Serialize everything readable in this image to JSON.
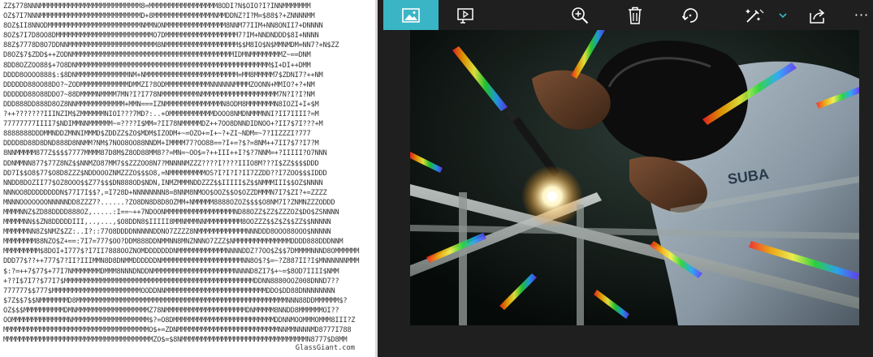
{
  "ascii_art": {
    "lines": [
      "ZZ$778NNNMMMMMMMMMMMMMMMMMMMMMMMMM8=MMMMMMMMMMMMMMMMM8ODI?N$OIO?I?INNMMMMMMM",
      "OZ$7I7NNNMMMMMMMMMMMMMMMMMMMMMMMMMD+8MMMMMMMMMMMMMMMNMMDDNZ?I?M=$88$?+ZNNNNMM",
      "8OZ$II8NNODMMMMMMMMMMMMMMMMMMMMMMMNMMNONMMMMMMMMMMMMMMM8NNM77IIM+NN8ONII7+DNNNN",
      "8OZ$7I7D8OO8DMMMMMMMMMMMMMMMMMMMMMMMMO7DMMMMMMMMMMMMMMMMMM7?IM+NNDNDDD$8I+NNNN",
      "88Z$7778D8O7DDNNMMMMMMMMMMMMMMMMMMMMMM8NMMMMMMMMMMMMMMMMMM$$M8IO$N$MMNMDM=NN7?+N$ZZ",
      "D8OZ$7$ZDD$++ZODNMMMMMMMMMMMMMMMMMMMMMMMMMMMMMMMMMMMMMMMMIDMNMMMMMMMMZ~==DNM",
      "8DD8OZZOO88$+7O8DNMMMMMMMMMMMMMMMMMMMMMMMMMMMMMMMMMMMMMMMMMMMMMMMM$I+DI++DMM",
      "DDDD8OOOO888$:$8DNMMMMMMMMMMMMMNM+NMMMMMMMMMMMMMMMMMMMMMMM=MM8MMMMM7$ZDNI7?++NM",
      "DDDDDD88OO88DO?~ZODMMMMMMMMMMMMDMMZI?8ODMMMMMMMMMMMNNNNNNMMMMZOONN+MMIO?+?+NM",
      "DDDDDD88O88DDO7~88DMMMMNMMMM7MN?I?I778NMMMMMMMMMNMMMMMMMMMMMMMMMMMMM7N?I?I?NM",
      "DDD888DD888D8OZ8NNMMMMMMMMMMMM+MMN===IZNMMMMMMMMMMMMMMN8ODM8MMMMMMMN8IOZI+I+$M",
      "?++???????IIINZIM$ZMMMMMMNIOI???7MD?:..+OMMMMMMMMMMMDOOO8NMDNMMMNNI?II7IIII?=M",
      "77777777IIII7$NDIMMNNMMMMMM~=????I$MM=?II78NMMMMMDZ++7OO8DNNDIDNOO+?II7$7I???+M",
      "8888888DDDMMNDDZMNNIMMMD$ZDDZZ$ZO$MDM$IZODM+~=OZO+=I+~?+ZI~NDM=~7?IIZZZI?777",
      "DDDD8D88D8DND888D8NNMM?NM$7NOO8OO88NNDM+IMMMM77?OO88==?I+=?$?=8NM++7II7$7?I7?M",
      "8NNMMMMM877Z$$$$7777MMMM87D8M$Z8OD88MM8??=MN=~OO$=?++III++I?$?7NNM=+?IIIII?O7NNN",
      "DDNMMNN877$77Z8NZ$$NNMZO87MM7$$ZZZOO8N7?MNNNNMZZZ????I????IIIO8M???I$ZZ$$$$DDD",
      "DD7I$$O8$77$O8D8ZZZ$NDDOOOZNMZZZO$$$O8,=NMMMMMMMMMOS?I?I?I?II7ZZDD??I7ZOO$$$IDDD",
      "NNDD8DOZII77$OZ8OOO$$Z77$$$DN888OD$NDN,INMZMMMNDDZZZ$$IIIII$Z$$NMMMIII$$OZ$NNNN",
      "NNNOO8DDDDDDDDN$77I7I$$?,=I728D+NNNNNNNN8=8NNM8NMOO$OOZ$$O$OZZDMMMN7I7$ZI?+=ZZZZ",
      "MNNNOOOOOOONNNNNDD8ZZZ7?......?ZO8DN8D8D8OZMM+NMMMMM8888OZOZ$$$$O8NM7I?ZNMNZZZODDD",
      "MMMMNNZ$ZD88DDDD888OZ,.....:I==~++7NDOONMMMMMMMMMMMMMMMMMND88OZZ$ZZ$ZZZOZ$DO$ZSNNNN",
      "MMMMMNN$$ZN8DDDDDIII,..,...,$O8DDN8$IIIII8MMNMMMNNMMMMMMMMM8OOZZZ$$Z$Z$$ZZ$$NNNNN",
      "MMMMMMNN8Z$NMZ$ZZ:..I?::77O8DDDDNNNNNDDNO7ZZZZ8NMMMMMMMMMMMMNNNDDD8OOO88OOO$NNNNN",
      "MMMMMMMM88NZO$Z+==:7I7=777$OO?DDM888DDNMMNN8MNZNNNO7ZZZ$NMMMMMMMMMMMMMMDDDD888DDDNNM",
      "MMMMMMMMM$8DOI+I777$?I7II7888OOZNOMDDDDDDDNMMMMMMMMMMMMNNNNDDZ?7OO$Z$$7DMMMMNNND8OMMMMMM",
      "DDD77$??++777$7?II?IIIMMN8D8DNMMDDDDDDNMMMMMMMMMMMMMMMMMMMMNN8O$?$=~?Z887II?I$MNNNNNNMMM",
      "$:?=++7$77$+77I7NMMMMMMMDMMM8NNNDNDDNMMMMMMMMMMMMMMMMMMMMNNNND8ZI7$+~=$8OD7IIII$NMM",
      "+??I$7I7?$77I7$MMMMMMMMMMMMMMMMMMMMMMMMMMMMMMMMMMMMMMMMMMMMMMMDDNN8880OOZ008DNND7??",
      "777777$$777$MMMMMMMMMMMMMMMMMMMMMMOODDNNMMMMMMMMMMMMMMMMMMMMMMMMMDDO$DD88DNNNNNNNN",
      "$7Z$$7$$NMMMMMMMD8MMMMMMMMMMMMMMMMMMMMMMMMMMMMMMMMMMMMMMMMMMMMMMMMMMMMNNN88DDMMMMMM$?",
      "OZ$$$MMMMMMMMMMDMNMMMMMMMMMMMMMMMMMMZ78NMMMMMMMMMMMMMMMMMMMMDNMMMMM8NNDD8MMMMMMOI??",
      "OOMMMMMMMMMMMMMMNMMMMMMMMMMMMMMMMMMM$?=O8DMMMMMMMMMMMMMMMMMMMMMMMMMDDNNMOOMMMOMMM8III?Z",
      "MMMMMMMMMMMMMMMMMMMMMMMMMMMMMMMMMMMMO$+=ZDNMMMMMMMMMMMMMMMMMMMMMMMMMNNMMNNNNMD8777I788",
      "MMMMMMMMMMMMMMMMMMMMMMMMMMMMMMMMMMMMMZO$=$8NMMMMMMMMMMMMMMMMMMMMMMMMMMMMMMMN8777$D8MM"
    ],
    "credit": "GlassGiant.com"
  },
  "toolbar": {
    "accent_color": "#39b5c6",
    "buttons": [
      {
        "name": "image-icon"
      },
      {
        "name": "slideshow-icon"
      },
      {
        "name": "zoom-in-icon"
      },
      {
        "name": "delete-icon"
      },
      {
        "name": "rotate-icon"
      },
      {
        "name": "edit-icon"
      },
      {
        "name": "share-icon"
      },
      {
        "name": "more-icon",
        "label": "···"
      }
    ]
  },
  "photo": {
    "shirt_text": "SUBA"
  }
}
